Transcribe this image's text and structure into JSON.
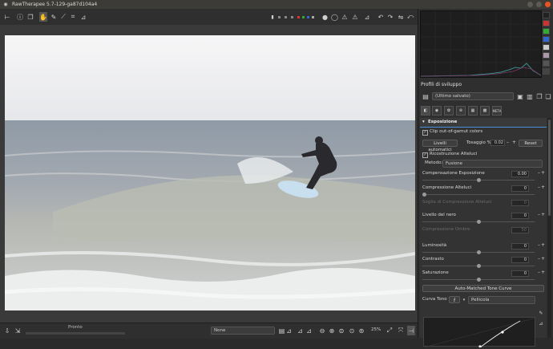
{
  "window": {
    "title": "RawTherapee 5.7-129-ga87d104a4"
  },
  "status": {
    "progress_label": "Pronto"
  },
  "bottom_toolbar": {
    "display_mode": "None",
    "zoom": "25%"
  },
  "profiles": {
    "header": "Profili di sviluppo",
    "selected": "(Ultimo salvato)"
  },
  "tabs": [
    {
      "label": "exposure-tab"
    },
    {
      "label": "detail-tab"
    },
    {
      "label": "color-tab"
    },
    {
      "label": "advanced-tab"
    },
    {
      "label": "transform-tab"
    },
    {
      "label": "raw-tab"
    },
    {
      "label": "META"
    }
  ],
  "exposure": {
    "title": "Esposizione",
    "clip_label": "Clip out-of-gamut colors",
    "auto_levels": "Livelli automatici",
    "clip_pct_label": "Tosaggio %",
    "clip_pct_value": "0.02",
    "reset": "Reset",
    "highlight_recon": "Ricostruzione Alteluci",
    "method_label": "Metodo:",
    "method_value": "Fusione",
    "comp_label": "Compensazione Esposizione",
    "comp_value": "0.00",
    "hl_comp_label": "Compressione Alteluci",
    "hl_comp_value": "0",
    "hl_thr_label": "Soglia di Compressione Alteluci",
    "hl_thr_value": "0",
    "black_label": "Livello del nero",
    "black_value": "0",
    "shadow_label": "Compressione Ombre",
    "shadow_value": "50",
    "lum_label": "Luminosità",
    "lum_value": "0",
    "con_label": "Contrasto",
    "con_value": "0",
    "sat_label": "Saturazione",
    "sat_value": "0",
    "tone_curve_btn": "Auto-Matched Tone Curve",
    "curve1_label": "Curva Tono 1:",
    "curve1_value": "Pellicola"
  }
}
